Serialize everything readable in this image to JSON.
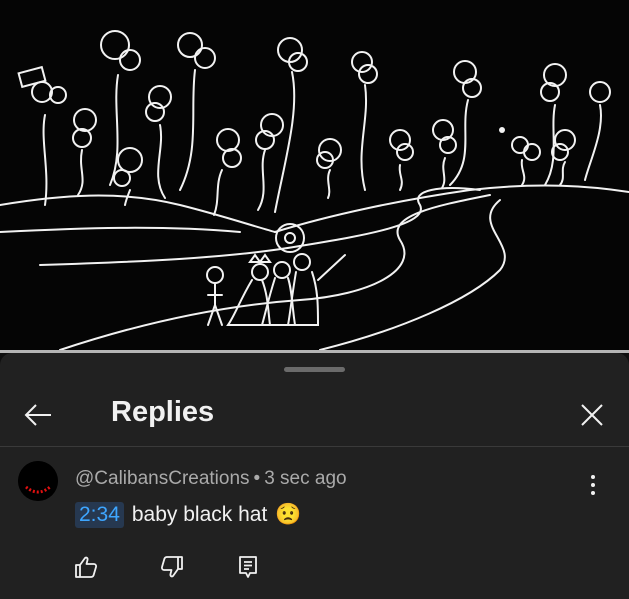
{
  "header": {
    "title": "Replies"
  },
  "comment": {
    "author": "@CalibansCreations",
    "separator": "•",
    "time_ago": "3 sec ago",
    "timestamp_link": "2:34",
    "text": "baby black hat",
    "emoji": "😟"
  },
  "icons": {
    "back": "arrow-left-icon",
    "close": "close-icon",
    "more": "more-vert-icon",
    "like": "thumb-up-icon",
    "dislike": "thumb-down-icon",
    "reply": "reply-comment-icon"
  },
  "colors": {
    "background": "#0f0f0f",
    "panel": "#212121",
    "timestamp_link": "#3ea6ff",
    "secondary_text": "#aaaaaa"
  }
}
